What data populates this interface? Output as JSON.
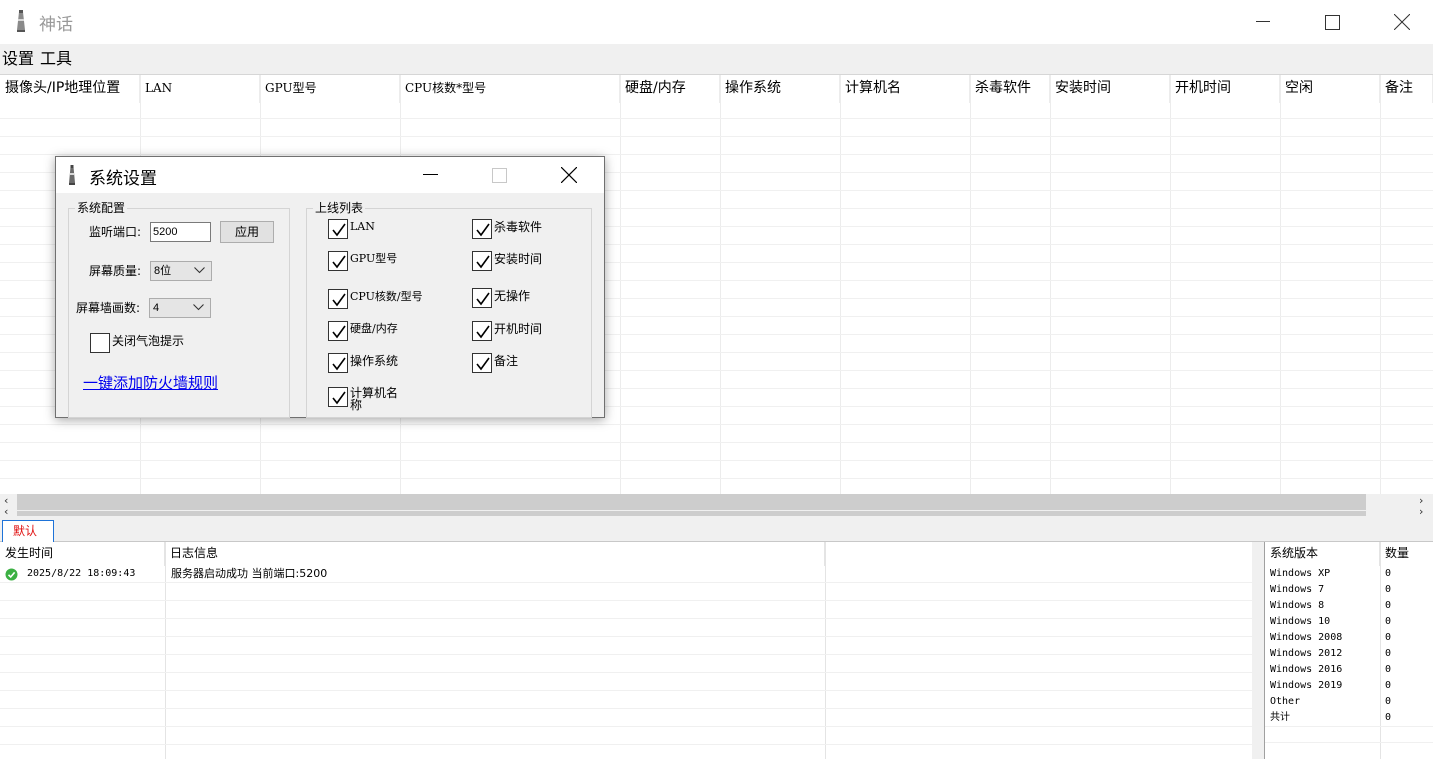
{
  "window": {
    "title": "神话"
  },
  "menu": {
    "items": [
      "设置",
      "工具"
    ]
  },
  "grid": {
    "columns": [
      "摄像头/IP地理位置",
      "LAN",
      "GPU型号",
      "CPU核数*型号",
      "硬盘/内存",
      "操作系统",
      "计算机名",
      "杀毒软件",
      "安装时间",
      "开机时间",
      "空闲",
      "备注"
    ]
  },
  "tabs": [
    "默认"
  ],
  "log": {
    "columns": [
      "发生时间",
      "日志信息"
    ],
    "rows": [
      {
        "time": "2025/8/22 18:09:43",
        "message": "服务器启动成功 当前端口:5200",
        "status": "success"
      }
    ]
  },
  "stats": {
    "columns": [
      "系统版本",
      "数量"
    ],
    "rows": [
      {
        "name": "Windows XP",
        "count": "0"
      },
      {
        "name": "Windows 7",
        "count": "0"
      },
      {
        "name": "Windows 8",
        "count": "0"
      },
      {
        "name": "Windows 10",
        "count": "0"
      },
      {
        "name": "Windows 2008",
        "count": "0"
      },
      {
        "name": "Windows 2012",
        "count": "0"
      },
      {
        "name": "Windows 2016",
        "count": "0"
      },
      {
        "name": "Windows 2019",
        "count": "0"
      },
      {
        "name": "Other",
        "count": "0"
      },
      {
        "name": "共计",
        "count": "0"
      }
    ]
  },
  "dialog": {
    "title": "系统设置",
    "system_config": {
      "group_label": "系统配置",
      "port_label": "监听端口:",
      "port_value": "5200",
      "apply_label": "应用",
      "quality_label": "屏幕质量:",
      "quality_value": "8位",
      "wall_label": "屏幕墙画数:",
      "wall_value": "4",
      "bubble_label": "关闭气泡提示",
      "bubble_checked": false,
      "firewall_link": "一键添加防火墙规则"
    },
    "online_list": {
      "group_label": "上线列表",
      "items": [
        {
          "label": "LAN",
          "checked": true
        },
        {
          "label": "杀毒软件",
          "checked": true
        },
        {
          "label": "GPU型号",
          "checked": true
        },
        {
          "label": "安装时间",
          "checked": true
        },
        {
          "label": "CPU核数/型号",
          "checked": true
        },
        {
          "label": "无操作",
          "checked": true
        },
        {
          "label": "硬盘/内存",
          "checked": true
        },
        {
          "label": "开机时间",
          "checked": true
        },
        {
          "label": "操作系统",
          "checked": true
        },
        {
          "label": "备注",
          "checked": true
        },
        {
          "label": "计算机名",
          "checked": true
        }
      ],
      "last_label_tail": "称"
    }
  },
  "colors": {
    "accent_blue": "#1e73d8",
    "tab_text_red": "#e01010",
    "link_blue": "#0000ee",
    "success_green": "#3cb043"
  },
  "icons": {
    "app": "lighthouse-icon",
    "minimize": "minimize-icon",
    "maximize": "maximize-icon",
    "close": "close-icon",
    "log_status": "check-circle-icon",
    "checkbox": "checkmark-icon"
  }
}
